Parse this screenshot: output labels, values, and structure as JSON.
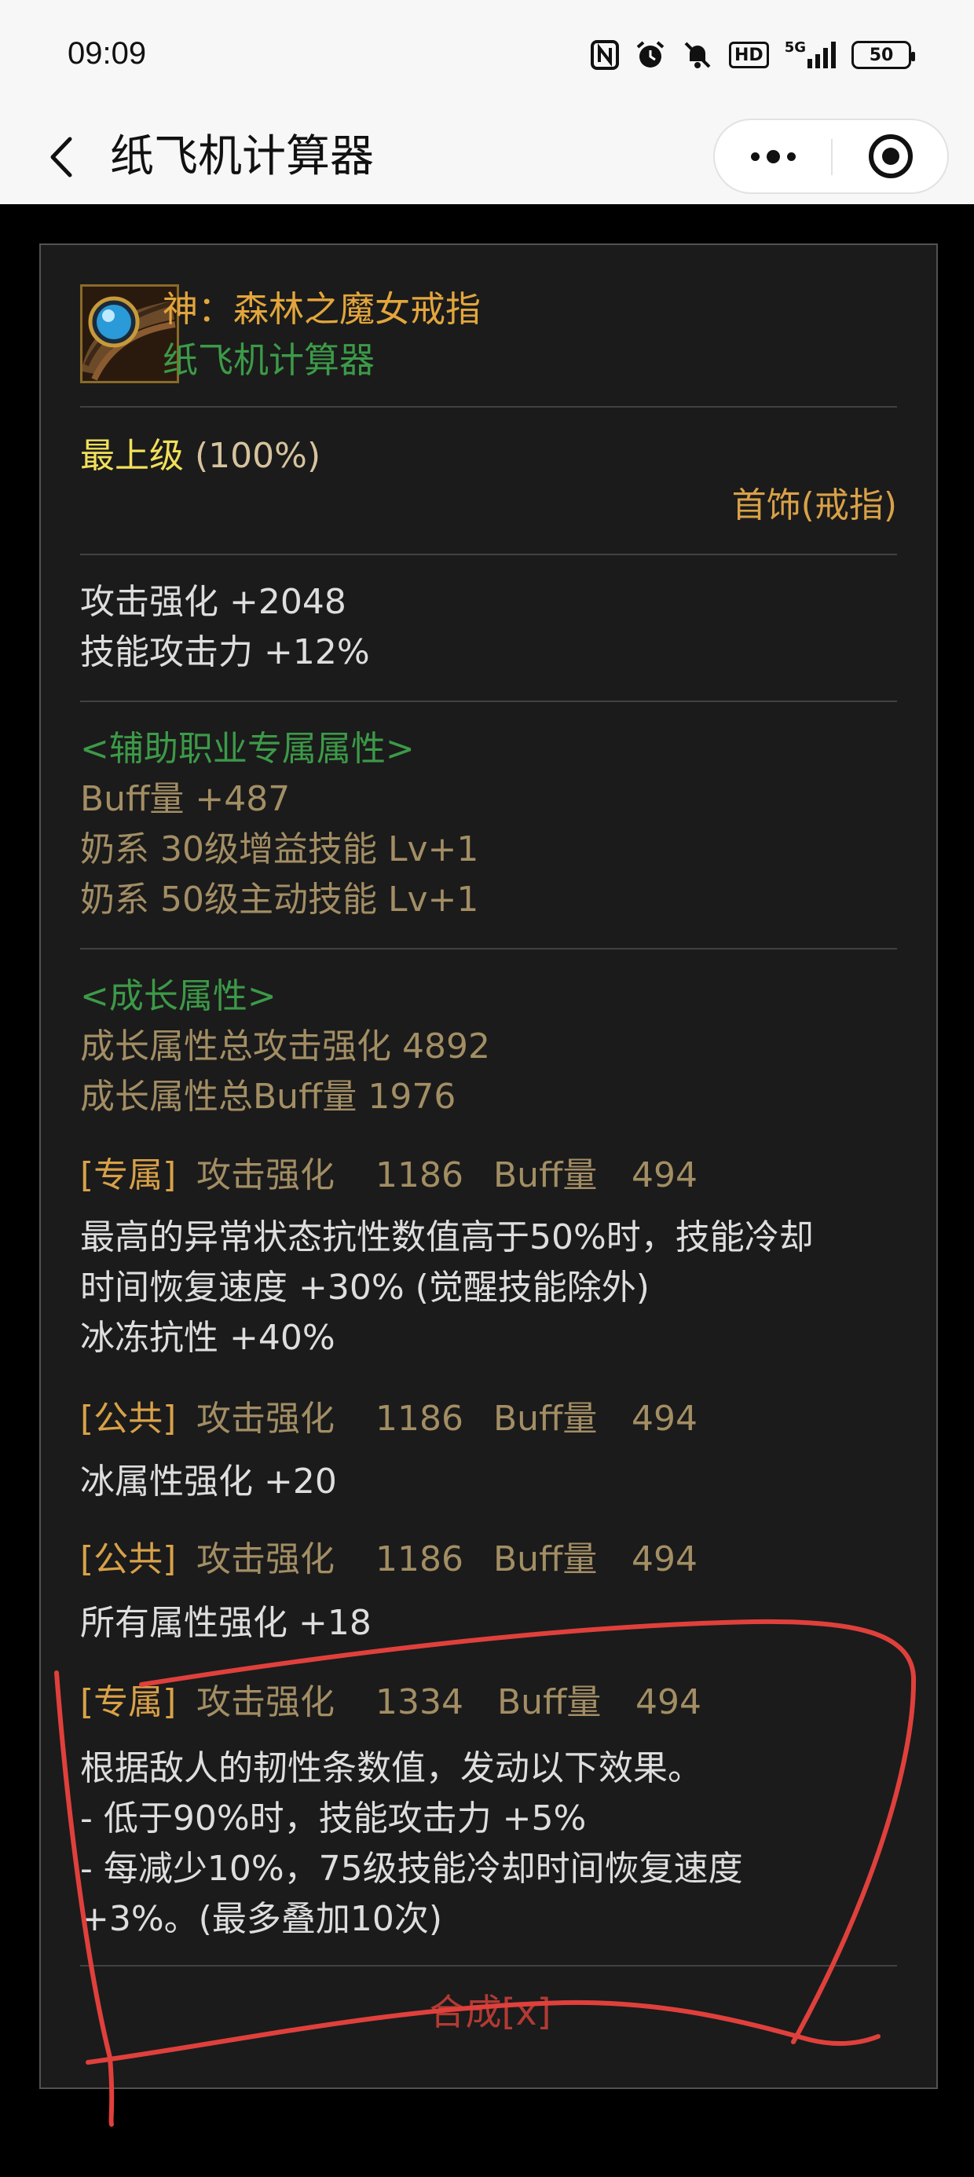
{
  "status_bar": {
    "time": "09:09",
    "icons": [
      "nfc-icon",
      "alarm-icon",
      "mute-icon",
      "hd-icon",
      "signal-5g-icon"
    ],
    "hd_label": "HD",
    "network_label": "5G",
    "battery": "50"
  },
  "nav": {
    "title": "纸飞机计算器"
  },
  "item": {
    "name": "神：森林之魔女戒指",
    "source": "纸飞机计算器",
    "grade": "最上级",
    "grade_percent": "(100%)",
    "slot": "首饰(戒指)",
    "base_stats": [
      "攻击强化 +2048",
      "技能攻击力 +12%"
    ],
    "support": {
      "header": "<辅助职业专属属性>",
      "lines": [
        "Buff量 +487",
        "奶系 30级增益技能 Lv+1",
        "奶系 50级主动技能 Lv+1"
      ]
    },
    "growth": {
      "header": "<成长属性>",
      "lines": [
        "成长属性总攻击强化 4892",
        "成长属性总Buff量 1976"
      ]
    },
    "options": [
      {
        "tag": "[专属]",
        "atk_label": "攻击强化",
        "atk_value": "1186",
        "buff_label": "Buff量",
        "buff_value": "494",
        "effects": [
          "最高的异常状态抗性数值高于50%时，技能冷却",
          "时间恢复速度 +30% (觉醒技能除外)",
          "冰冻抗性 +40%"
        ]
      },
      {
        "tag": "[公共]",
        "atk_label": "攻击强化",
        "atk_value": "1186",
        "buff_label": "Buff量",
        "buff_value": "494",
        "effects": [
          "冰属性强化 +20"
        ]
      },
      {
        "tag": "[公共]",
        "atk_label": "攻击强化",
        "atk_value": "1186",
        "buff_label": "Buff量",
        "buff_value": "494",
        "effects": [
          "所有属性强化 +18"
        ]
      },
      {
        "tag": "[专属]",
        "atk_label": "攻击强化",
        "atk_value": "1334",
        "buff_label": "Buff量",
        "buff_value": "494",
        "effects": [
          "根据敌人的韧性条数值，发动以下效果。",
          "- 低于90%时，技能攻击力 +5%",
          "- 每减少10%，75级技能冷却时间恢复速度",
          "+3%。(最多叠加10次)"
        ]
      }
    ],
    "craft_label": "合成[x]"
  },
  "colors": {
    "name": "#e3a63c",
    "green": "#3c9a48",
    "grade": "#f1e05a",
    "annotation": "#e0403c"
  }
}
